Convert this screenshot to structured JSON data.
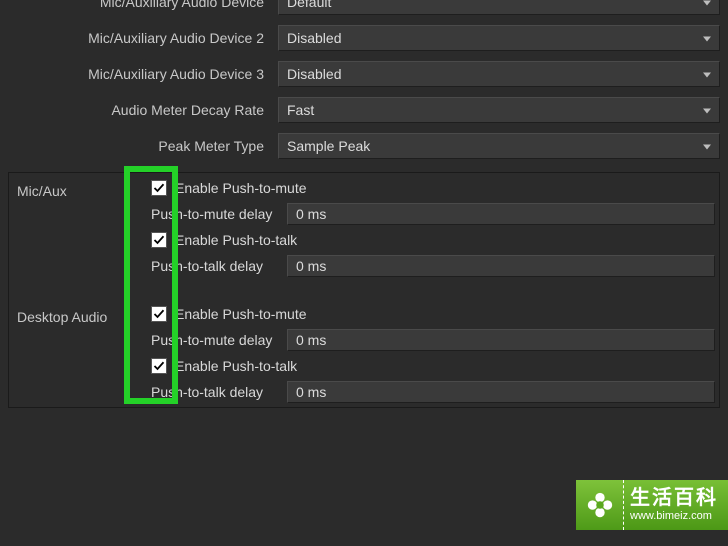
{
  "settings": {
    "mic_aux_device": {
      "label": "Mic/Auxiliary Audio Device",
      "value": "Default"
    },
    "mic_aux_device_2": {
      "label": "Mic/Auxiliary Audio Device 2",
      "value": "Disabled"
    },
    "mic_aux_device_3": {
      "label": "Mic/Auxiliary Audio Device 3",
      "value": "Disabled"
    },
    "decay_rate": {
      "label": "Audio Meter Decay Rate",
      "value": "Fast"
    },
    "peak_meter_type": {
      "label": "Peak Meter Type",
      "value": "Sample Peak"
    }
  },
  "hotkey_groups": {
    "mic_aux": {
      "title": "Mic/Aux",
      "push_to_mute_enable_label": "Enable Push-to-mute",
      "push_to_mute_enable_checked": true,
      "push_to_mute_delay_label": "Push-to-mute delay",
      "push_to_mute_delay_value": "0 ms",
      "push_to_talk_enable_label": "Enable Push-to-talk",
      "push_to_talk_enable_checked": true,
      "push_to_talk_delay_label": "Push-to-talk delay",
      "push_to_talk_delay_value": "0 ms"
    },
    "desktop_audio": {
      "title": "Desktop Audio",
      "push_to_mute_enable_label": "Enable Push-to-mute",
      "push_to_mute_enable_checked": true,
      "push_to_mute_delay_label": "Push-to-mute delay",
      "push_to_mute_delay_value": "0 ms",
      "push_to_talk_enable_label": "Enable Push-to-talk",
      "push_to_talk_enable_checked": true,
      "push_to_talk_delay_label": "Push-to-talk delay",
      "push_to_talk_delay_value": "0 ms"
    }
  },
  "watermark": {
    "title": "生活百科",
    "url": "www.bimeiz.com"
  }
}
